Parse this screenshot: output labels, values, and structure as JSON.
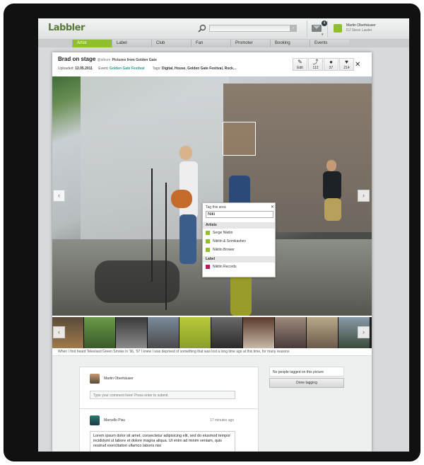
{
  "app": {
    "logo": "Labbler"
  },
  "search": {
    "placeholder": "",
    "go_label": "›"
  },
  "messages": {
    "count": "4"
  },
  "user": {
    "name": "Martin Oberhäuser",
    "role": "DJ Steve Lawler"
  },
  "nav": {
    "tabs": [
      "Artist",
      "Label",
      "Club",
      "Fan",
      "Promoter",
      "Booking",
      "Events"
    ],
    "active": "Artist"
  },
  "photo": {
    "title": "Brad on stage",
    "album_prefix": "@album",
    "album": "Pictures from Golden Gate",
    "uploaded_label": "Uploaded:",
    "uploaded_date": "12.05.2011",
    "event_label": "Event:",
    "event": "Golden Gate Festival",
    "tags_label": "Tags:",
    "tags": "Digital, House, Golden Gate Festival, Rock...",
    "caption": "When I first heard Televised Green Smoke in '96, '97 I knew I was deprived of something that was lost a long time ago at this time, for many reasons"
  },
  "stats": {
    "edit_label": "Edit",
    "shares": "112",
    "comments": "37",
    "likes": "214"
  },
  "tag_popup": {
    "header": "Tag this area",
    "input_value": "Niki",
    "artists_heading": "Artists",
    "artists": [
      "Serge Nikitin",
      "Nikitin & Semikashev",
      "Nikitin Brower"
    ],
    "label_heading": "Label",
    "labels": [
      "Nikitin Records"
    ]
  },
  "comments": {
    "current_user": "Martin Oberhäuser",
    "placeholder": "Type your comment here! Press enter to submit.",
    "items": [
      {
        "author": "Marcello Pisu",
        "time": "17 minutes ago",
        "text": "Lorem ipsum dolor sit amet, consectetur adipisicing elit, sed do eiusmod tempor incididunt ut labore et dolore magna aliqua. Ut enim ad minim veniam, quis nostrud exercitation ullamco laboris nisi"
      }
    ]
  },
  "tagging": {
    "status": "No people tagged on this picture",
    "done_label": "Done tagging"
  },
  "colors": {
    "accent_green": "#8fbf2f",
    "link_teal": "#2a9a8a",
    "label_magenta": "#c2185b"
  }
}
